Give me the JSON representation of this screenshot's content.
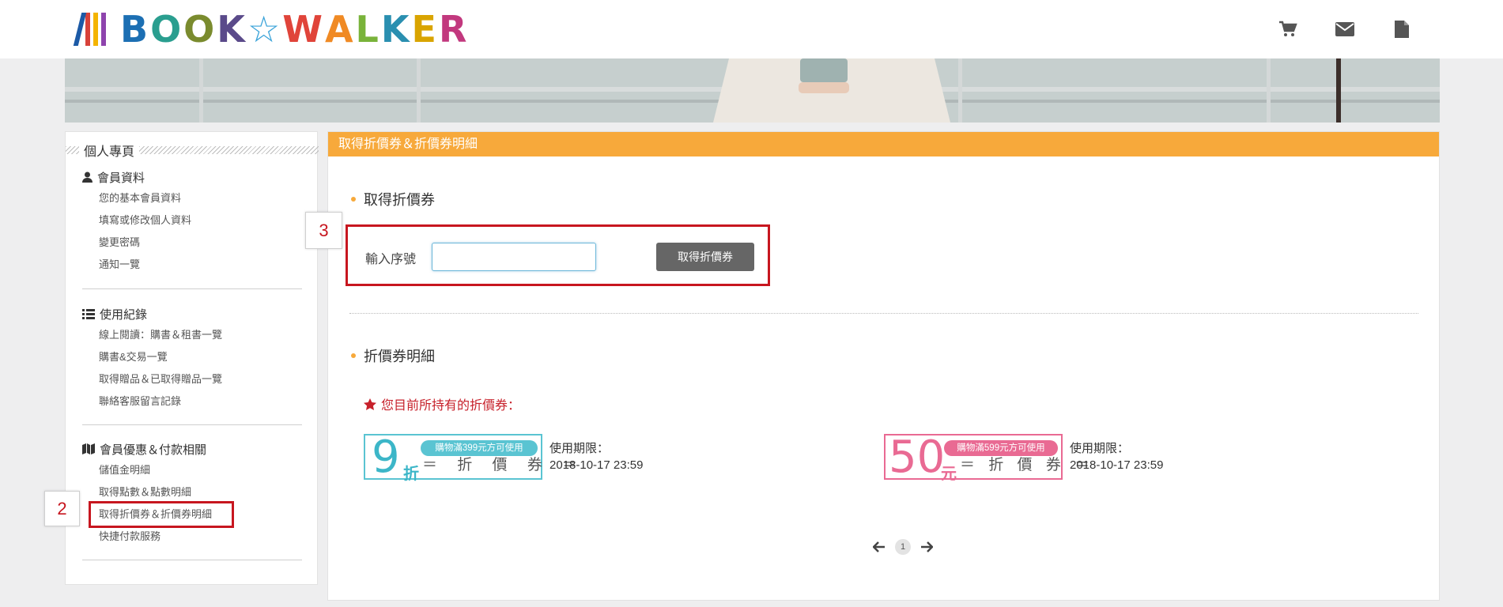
{
  "header": {
    "logo": {
      "letters": [
        "B",
        "O",
        "O",
        "K",
        "☆",
        "W",
        "A",
        "L",
        "K",
        "E",
        "R"
      ]
    },
    "icons": [
      "cart-icon",
      "mail-icon",
      "document-icon"
    ]
  },
  "sidebar": {
    "title": "個人專頁",
    "groups": [
      {
        "icon": "user-icon",
        "label": "會員資料",
        "items": [
          "您的基本會員資料",
          "填寫或修改個人資料",
          "變更密碼",
          "通知一覽"
        ]
      },
      {
        "icon": "list-icon",
        "label": "使用紀錄",
        "items": [
          "線上閱讀：購書＆租書一覽",
          "購書&交易一覽",
          "取得贈品＆已取得贈品一覽",
          "聯絡客服留言記錄"
        ]
      },
      {
        "icon": "map-icon",
        "label": "會員優惠＆付款相關",
        "items": [
          "儲值金明細",
          "取得點數＆點數明細",
          "取得折價券＆折價券明細",
          "快捷付款服務"
        ]
      }
    ]
  },
  "main": {
    "header_title": "取得折價券＆折價券明細",
    "get_coupon": {
      "title": "取得折價券",
      "input_label": "輸入序號",
      "input_value": "",
      "button_label": "取得折價券"
    },
    "coupon_detail": {
      "title": "折價券明細",
      "owned_label": "您目前所持有的折價券：",
      "coupons": [
        {
          "amount": "9",
          "unit": "折",
          "condition": "購物滿399元方可使用",
          "type": "＝ 折 價 券 ＝",
          "expire_label": "使用期限：",
          "expire": "2018-10-17 23:59",
          "color": "#5ac4d2"
        },
        {
          "amount": "50",
          "unit": "元",
          "condition": "購物滿599元方可使用",
          "type": "＝ 折 價 券 ＝",
          "expire_label": "使用期限：",
          "expire": "2018-10-17 23:59",
          "color": "#e96a93"
        }
      ]
    },
    "pagination": {
      "current": "1"
    }
  },
  "annotations": {
    "step2": "2",
    "step3": "3"
  },
  "colors": {
    "accent": "#f7a93b",
    "annotation": "#c7161f",
    "button": "#666666"
  }
}
